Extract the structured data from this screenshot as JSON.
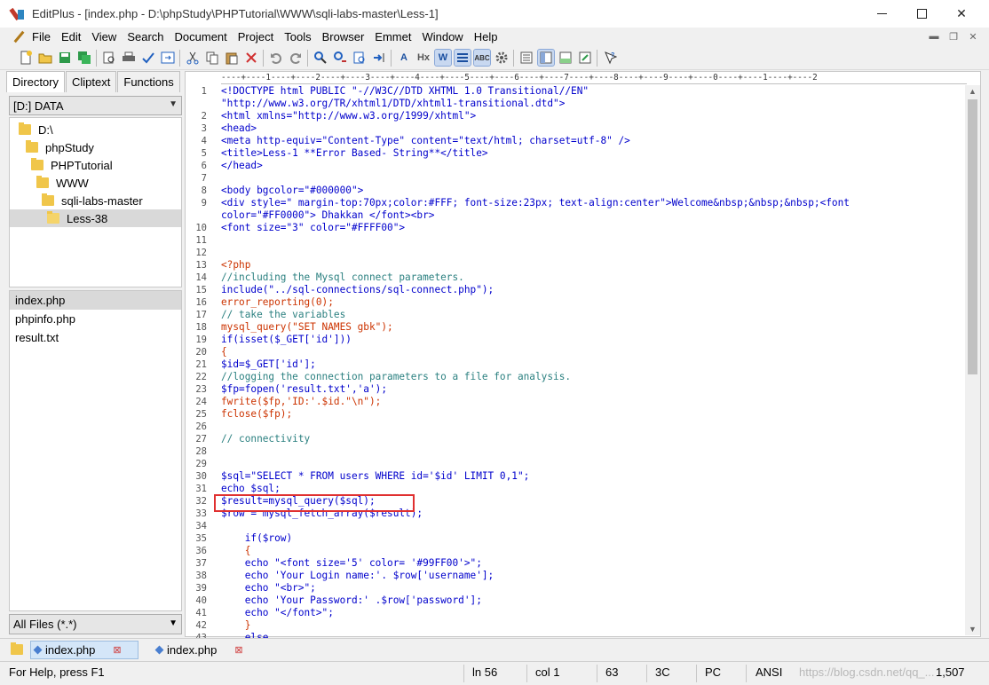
{
  "window": {
    "title": "EditPlus - [index.php - D:\\phpStudy\\PHPTutorial\\WWW\\sqli-labs-master\\Less-1]"
  },
  "menu": [
    "File",
    "Edit",
    "View",
    "Search",
    "Document",
    "Project",
    "Tools",
    "Browser",
    "Emmet",
    "Window",
    "Help"
  ],
  "toolbar": {
    "icons": [
      "new-file",
      "open",
      "save",
      "save-all",
      "print-preview",
      "print",
      "spell-check",
      "browser-preview",
      "cut",
      "copy",
      "paste",
      "delete",
      "undo",
      "redo",
      "find",
      "replace",
      "find-in-files",
      "goto-line",
      "font",
      "html-toolbar",
      "word-wrap",
      "line-number",
      "column-marker",
      "ruler",
      "preferences",
      "cliptext",
      "directory",
      "output",
      "fullscreen",
      "help"
    ]
  },
  "left_panel": {
    "tabs": [
      "Directory",
      "Cliptext",
      "Functions"
    ],
    "drive": "[D:] DATA",
    "tree": [
      "D:\\",
      "phpStudy",
      "PHPTutorial",
      "WWW",
      "sqli-labs-master",
      "Less-38"
    ],
    "files": [
      "index.php",
      "phpinfo.php",
      "result.txt"
    ],
    "filter": "All Files (*.*)"
  },
  "editor": {
    "ruler": "----+----1----+----2----+----3----+----4----+----5----+----6----+----7----+----8----+----9----+----0----+----1----+----2",
    "lines": [
      {
        "n": "1",
        "text": "<!DOCTYPE html PUBLIC \"-//W3C//DTD XHTML 1.0 Transitional//EN\"",
        "cls": "c-tag"
      },
      {
        "n": "",
        "text": "\"http://www.w3.org/TR/xhtml1/DTD/xhtml1-transitional.dtd\">",
        "cls": "c-tag"
      },
      {
        "n": "2",
        "text": "<html xmlns=\"http://www.w3.org/1999/xhtml\">",
        "cls": "c-tag"
      },
      {
        "n": "3",
        "text": "<head>",
        "cls": "c-tag"
      },
      {
        "n": "4",
        "text": "<meta http-equiv=\"Content-Type\" content=\"text/html; charset=utf-8\" />",
        "cls": "c-tag"
      },
      {
        "n": "5",
        "text": "<title>Less-1 **Error Based- String**</title>",
        "cls": "c-tag"
      },
      {
        "n": "6",
        "text": "</head>",
        "cls": "c-tag"
      },
      {
        "n": "7",
        "text": "",
        "cls": "c-txt"
      },
      {
        "n": "8",
        "text": "<body bgcolor=\"#000000\">",
        "cls": "c-tag"
      },
      {
        "n": "9",
        "text": "<div style=\" margin-top:70px;color:#FFF; font-size:23px; text-align:center\">Welcome&nbsp;&nbsp;&nbsp;<font",
        "cls": "c-tag"
      },
      {
        "n": "",
        "text": "color=\"#FF0000\"> Dhakkan </font><br>",
        "cls": "c-tag"
      },
      {
        "n": "10",
        "text": "<font size=\"3\" color=\"#FFFF00\">",
        "cls": "c-tag"
      },
      {
        "n": "11",
        "text": "",
        "cls": "c-txt"
      },
      {
        "n": "12",
        "text": "",
        "cls": "c-txt"
      },
      {
        "n": "13",
        "text": "<?php",
        "cls": "c-php"
      },
      {
        "n": "14",
        "text": "//including the Mysql connect parameters.",
        "cls": "c-cmt"
      },
      {
        "n": "15",
        "text": "include(\"../sql-connections/sql-connect.php\");",
        "cls": "c-fn"
      },
      {
        "n": "16",
        "text": "error_reporting(0);",
        "cls": "c-php"
      },
      {
        "n": "17",
        "text": "// take the variables",
        "cls": "c-cmt"
      },
      {
        "n": "18",
        "text": "mysql_query(\"SET NAMES gbk\");",
        "cls": "c-php"
      },
      {
        "n": "19",
        "text": "if(isset($_GET['id']))",
        "cls": "c-fn"
      },
      {
        "n": "20",
        "text": "{",
        "cls": "c-php"
      },
      {
        "n": "21",
        "text": "$id=$_GET['id'];",
        "cls": "c-var"
      },
      {
        "n": "22",
        "text": "//logging the connection parameters to a file for analysis.",
        "cls": "c-cmt"
      },
      {
        "n": "23",
        "text": "$fp=fopen('result.txt','a');",
        "cls": "c-var"
      },
      {
        "n": "24",
        "text": "fwrite($fp,'ID:'.$id.\"\\n\");",
        "cls": "c-php"
      },
      {
        "n": "25",
        "text": "fclose($fp);",
        "cls": "c-php"
      },
      {
        "n": "26",
        "text": "",
        "cls": "c-txt"
      },
      {
        "n": "27",
        "text": "// connectivity",
        "cls": "c-cmt"
      },
      {
        "n": "28",
        "text": "",
        "cls": "c-txt"
      },
      {
        "n": "29",
        "text": "",
        "cls": "c-txt"
      },
      {
        "n": "30",
        "text": "$sql=\"SELECT * FROM users WHERE id='$id' LIMIT 0,1\";",
        "cls": "c-var"
      },
      {
        "n": "31",
        "text": "echo $sql;",
        "cls": "c-fn"
      },
      {
        "n": "32",
        "text": "$result=mysql_query($sql);",
        "cls": "c-var"
      },
      {
        "n": "33",
        "text": "$row = mysql_fetch_array($result);",
        "cls": "c-var"
      },
      {
        "n": "34",
        "text": "",
        "cls": "c-txt"
      },
      {
        "n": "35",
        "text": "    if($row)",
        "cls": "c-fn"
      },
      {
        "n": "36",
        "text": "    {",
        "cls": "c-php"
      },
      {
        "n": "37",
        "text": "    echo \"<font size='5' color= '#99FF00'>\";",
        "cls": "c-fn"
      },
      {
        "n": "38",
        "text": "    echo 'Your Login name:'. $row['username'];",
        "cls": "c-fn"
      },
      {
        "n": "39",
        "text": "    echo \"<br>\";",
        "cls": "c-fn"
      },
      {
        "n": "40",
        "text": "    echo 'Your Password:' .$row['password'];",
        "cls": "c-fn"
      },
      {
        "n": "41",
        "text": "    echo \"</font>\";",
        "cls": "c-fn"
      },
      {
        "n": "42",
        "text": "    }",
        "cls": "c-php"
      },
      {
        "n": "43",
        "text": "    else",
        "cls": "c-fn"
      }
    ]
  },
  "doc_tabs": [
    "index.php",
    "index.php"
  ],
  "status": {
    "help": "For Help, press F1",
    "ln": "ln 56",
    "col": "col 1",
    "num": "63",
    "hex": "3C",
    "eol": "PC",
    "encoding": "ANSI",
    "size": "1,507",
    "watermark": "https://blog.csdn.net/qq_..."
  }
}
